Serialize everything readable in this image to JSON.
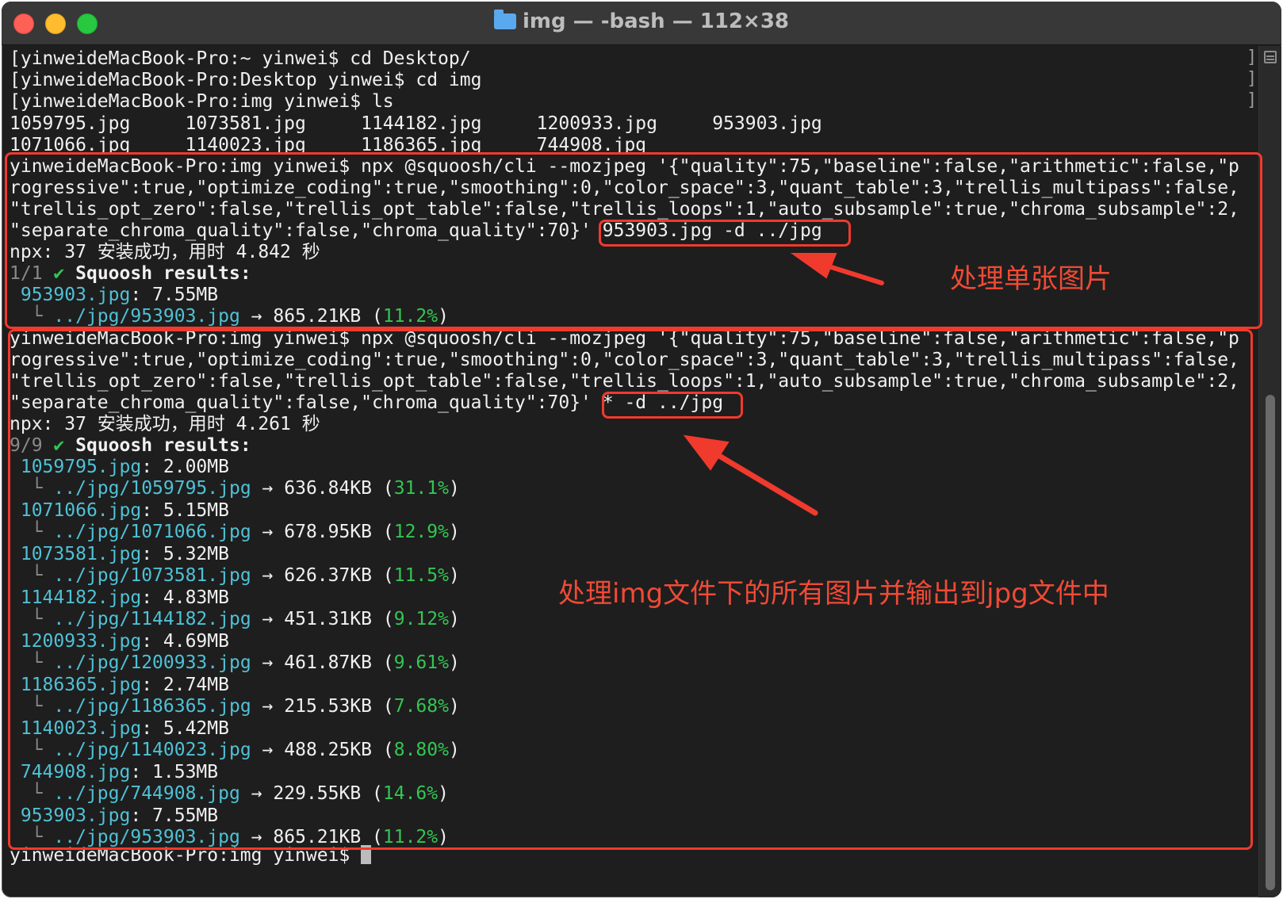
{
  "window": {
    "title": "img — -bash — 112×38"
  },
  "terminal": {
    "prompt_line_1": "[yinweideMacBook-Pro:~ yinwei$ cd Desktop/",
    "prompt_line_2": "[yinweideMacBook-Pro:Desktop yinwei$ cd img",
    "prompt_line_3": "[yinweideMacBook-Pro:img yinwei$ ls",
    "ls_row_1": "1059795.jpg     1073581.jpg     1144182.jpg     1200933.jpg     953903.jpg",
    "ls_row_2": "1071066.jpg     1140023.jpg     1186365.jpg     744908.jpg",
    "cmd1_line_1": "yinweideMacBook-Pro:img yinwei$ npx @squoosh/cli --mozjpeg '{\"quality\":75,\"baseline\":false,\"arithmetic\":false,\"p",
    "cmd1_line_2": "rogressive\":true,\"optimize_coding\":true,\"smoothing\":0,\"color_space\":3,\"quant_table\":3,\"trellis_multipass\":false,",
    "cmd1_line_3": "\"trellis_opt_zero\":false,\"trellis_opt_table\":false,\"trellis_loops\":1,\"auto_subsample\":true,\"chroma_subsample\":2,",
    "cmd1_line_4a": "\"separate_chroma_quality\":false,\"chroma_quality\":70}'",
    "cmd1_line_4b": " 953903.jpg -d ../jpg",
    "cmd1_install": "npx: 37 安装成功，用时 4.842 秒",
    "cmd1_progress": "1/1",
    "check_mark": "✔",
    "results_label": "Squoosh results:",
    "cmd1_result_file": "953903.jpg",
    "cmd1_result_size": ": 7.55MB",
    "tree_char": "└",
    "cmd1_result_out": "../jpg/953903.jpg",
    "arrow_char": "→",
    "cmd1_result_new": "865.21KB",
    "cmd1_result_pct": "11.2%",
    "cmd2_line_1": "yinweideMacBook-Pro:img yinwei$ npx @squoosh/cli --mozjpeg '{\"quality\":75,\"baseline\":false,\"arithmetic\":false,\"p",
    "cmd2_line_2": "rogressive\":true,\"optimize_coding\":true,\"smoothing\":0,\"color_space\":3,\"quant_table\":3,\"trellis_multipass\":false,",
    "cmd2_line_3": "\"trellis_opt_zero\":false,\"trellis_opt_table\":false,\"trellis_loops\":1,\"auto_subsample\":true,\"chroma_subsample\":2,",
    "cmd2_line_4a": "\"separate_chroma_quality\":false,\"chroma_quality\":70}'",
    "cmd2_line_4b": " * -d ../jpg",
    "cmd2_install": "npx: 37 安装成功，用时 4.261 秒",
    "cmd2_progress": "9/9",
    "results": [
      {
        "file": "1059795.jpg",
        "size": ": 2.00MB",
        "out": "../jpg/1059795.jpg",
        "new": "636.84KB",
        "pct": "31.1%"
      },
      {
        "file": "1071066.jpg",
        "size": ": 5.15MB",
        "out": "../jpg/1071066.jpg",
        "new": "678.95KB",
        "pct": "12.9%"
      },
      {
        "file": "1073581.jpg",
        "size": ": 5.32MB",
        "out": "../jpg/1073581.jpg",
        "new": "626.37KB",
        "pct": "11.5%"
      },
      {
        "file": "1144182.jpg",
        "size": ": 4.83MB",
        "out": "../jpg/1144182.jpg",
        "new": "451.31KB",
        "pct": "9.12%"
      },
      {
        "file": "1200933.jpg",
        "size": ": 4.69MB",
        "out": "../jpg/1200933.jpg",
        "new": "461.87KB",
        "pct": "9.61%"
      },
      {
        "file": "1186365.jpg",
        "size": ": 2.74MB",
        "out": "../jpg/1186365.jpg",
        "new": "215.53KB",
        "pct": "7.68%"
      },
      {
        "file": "1140023.jpg",
        "size": ": 5.42MB",
        "out": "../jpg/1140023.jpg",
        "new": "488.25KB",
        "pct": "8.80%"
      },
      {
        "file": "744908.jpg",
        "size": ": 1.53MB",
        "out": "../jpg/744908.jpg",
        "new": "229.55KB",
        "pct": "14.6%"
      },
      {
        "file": "953903.jpg",
        "size": ": 7.55MB",
        "out": "../jpg/953903.jpg",
        "new": "865.21KB",
        "pct": "11.2%"
      }
    ],
    "final_prompt": "yinweideMacBook-Pro:img yinwei$ "
  },
  "annotations": {
    "single": "处理单张图片",
    "batch": "处理img文件下的所有图片并输出到jpg文件中",
    "color": "#f03a2e"
  },
  "colors": {
    "background": "#1e1e1e",
    "text": "#f0f0f0",
    "filename": "#4fc1d6",
    "percent": "#33c553"
  }
}
